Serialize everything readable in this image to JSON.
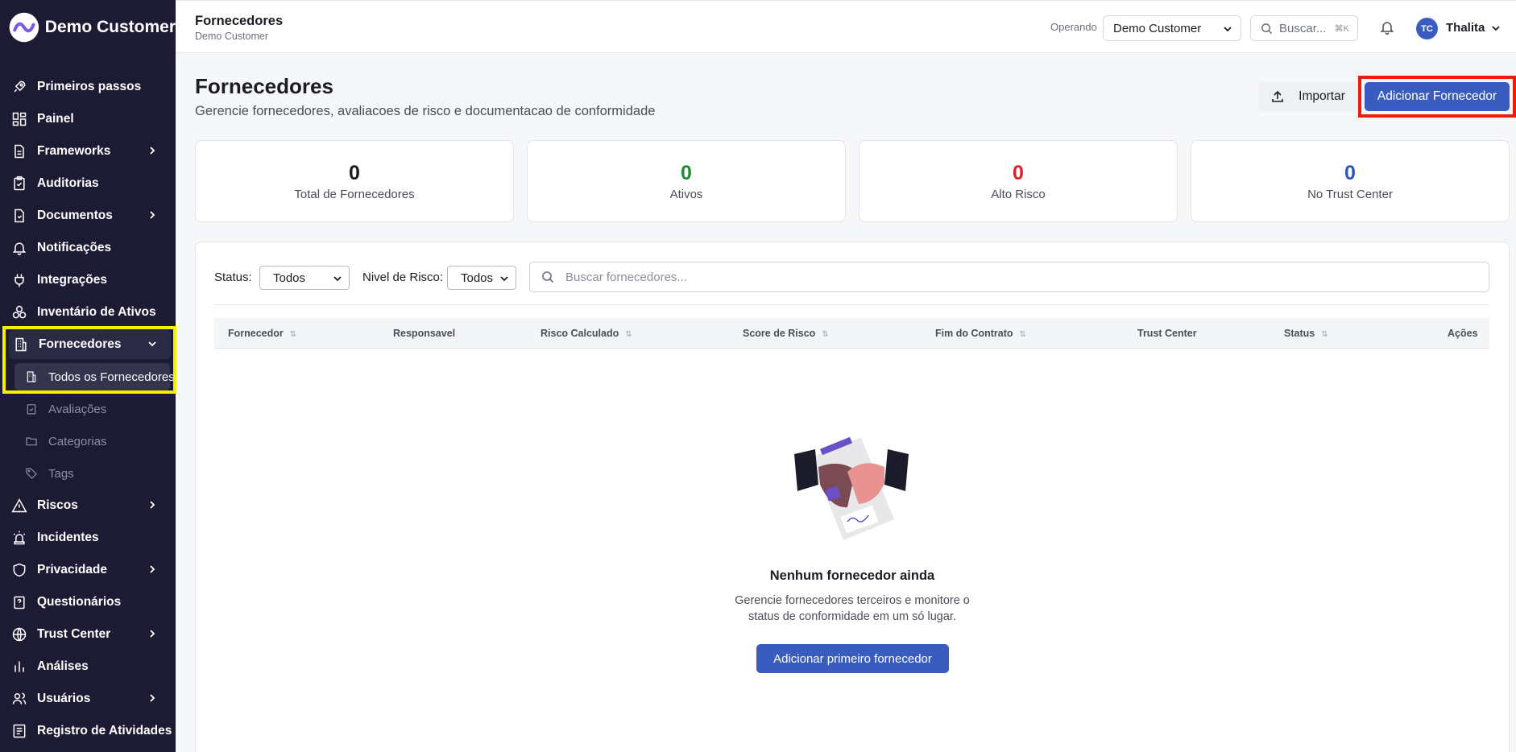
{
  "brand": {
    "name": "Demo Customer"
  },
  "sidebar": {
    "items": [
      {
        "label": "Primeiros passos",
        "icon": "rocket-icon"
      },
      {
        "label": "Painel",
        "icon": "dashboard-icon"
      },
      {
        "label": "Frameworks",
        "icon": "file-icon",
        "expandable": true
      },
      {
        "label": "Auditorias",
        "icon": "clipboard-icon"
      },
      {
        "label": "Documentos",
        "icon": "document-icon",
        "expandable": true
      },
      {
        "label": "Notificações",
        "icon": "bell-icon"
      },
      {
        "label": "Integrações",
        "icon": "plug-icon"
      },
      {
        "label": "Inventário de Ativos",
        "icon": "boxes-icon"
      },
      {
        "label": "Fornecedores",
        "icon": "building-icon",
        "expanded": true
      },
      {
        "label": "Todos os Fornecedores",
        "icon": "building-icon",
        "sub": true,
        "active": true
      },
      {
        "label": "Avaliações",
        "icon": "clipboard-check-icon",
        "sub": true
      },
      {
        "label": "Categorias",
        "icon": "folder-icon",
        "sub": true
      },
      {
        "label": "Tags",
        "icon": "tag-icon",
        "sub": true
      },
      {
        "label": "Riscos",
        "icon": "warning-icon",
        "expandable": true
      },
      {
        "label": "Incidentes",
        "icon": "siren-icon"
      },
      {
        "label": "Privacidade",
        "icon": "shield-icon",
        "expandable": true
      },
      {
        "label": "Questionários",
        "icon": "questionnaire-icon"
      },
      {
        "label": "Trust Center",
        "icon": "globe-icon",
        "expandable": true
      },
      {
        "label": "Análises",
        "icon": "chart-icon"
      },
      {
        "label": "Usuários",
        "icon": "users-icon",
        "expandable": true
      },
      {
        "label": "Registro de Atividades",
        "icon": "log-icon"
      }
    ]
  },
  "topbar": {
    "title": "Fornecedores",
    "subtitle": "Demo Customer",
    "operando_label": "Operando",
    "operando_value": "Demo Customer",
    "search_placeholder": "Buscar...",
    "search_shortcut": "⌘K",
    "user_initials": "TC",
    "user_name": "Thalita"
  },
  "page": {
    "title": "Fornecedores",
    "subtitle": "Gerencie fornecedores, avaliacoes de risco e documentacao de conformidade",
    "import_label": "Importar",
    "add_label": "Adicionar Fornecedor"
  },
  "stats": [
    {
      "value": "0",
      "label": "Total de Fornecedores",
      "color": "#1c1d22"
    },
    {
      "value": "0",
      "label": "Ativos",
      "color": "#1f8a3a"
    },
    {
      "value": "0",
      "label": "Alto Risco",
      "color": "#d6232a"
    },
    {
      "value": "0",
      "label": "No Trust Center",
      "color": "#2d55b8"
    }
  ],
  "filters": {
    "status_label": "Status:",
    "status_value": "Todos",
    "risk_label": "Nivel de Risco:",
    "risk_value": "Todos",
    "search_placeholder": "Buscar fornecedores..."
  },
  "table": {
    "columns": [
      {
        "label": "Fornecedor",
        "sortable": true
      },
      {
        "label": "Responsavel",
        "sortable": false
      },
      {
        "label": "Risco Calculado",
        "sortable": true
      },
      {
        "label": "Score de Risco",
        "sortable": true
      },
      {
        "label": "Fim do Contrato",
        "sortable": true
      },
      {
        "label": "Trust Center",
        "sortable": false
      },
      {
        "label": "Status",
        "sortable": true
      },
      {
        "label": "Ações",
        "sortable": false
      }
    ]
  },
  "empty": {
    "title": "Nenhum fornecedor ainda",
    "description_line1": "Gerencie fornecedores terceiros e monitore o",
    "description_line2": "status de conformidade em um só lugar.",
    "button_label": "Adicionar primeiro fornecedor"
  },
  "colors": {
    "sidebar_bg": "#1c1b33",
    "primary": "#3b5cbf",
    "highlight_yellow": "#f4f000",
    "highlight_red": "#f01b0f"
  }
}
